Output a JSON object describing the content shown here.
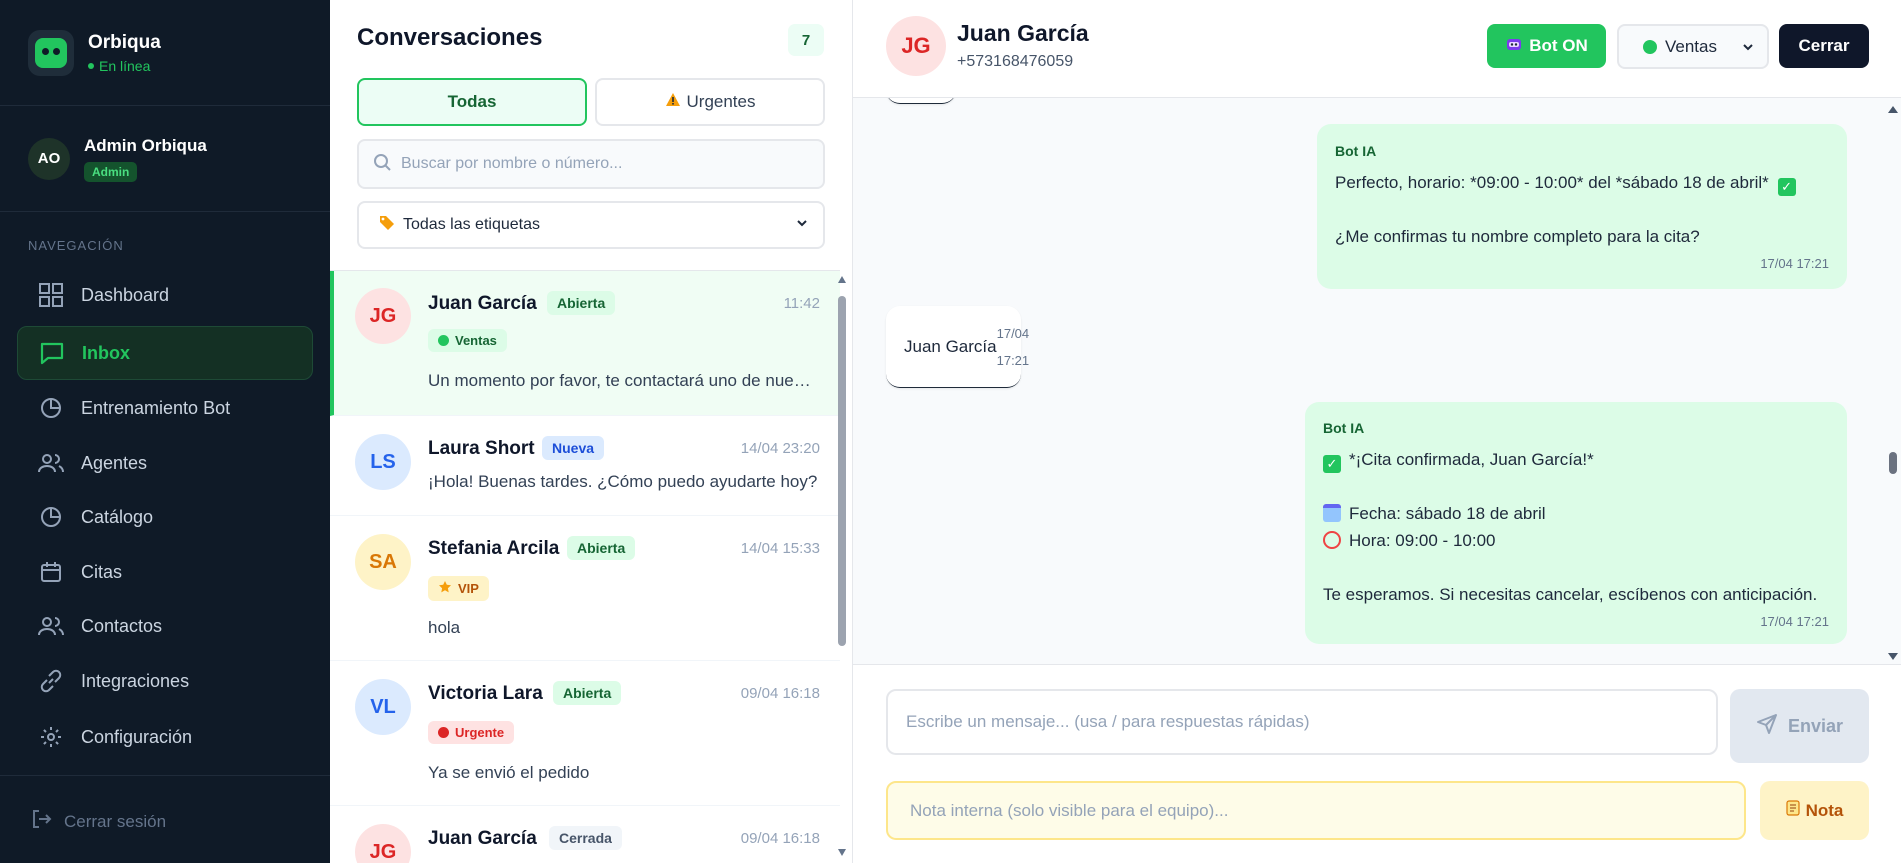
{
  "brand": {
    "name": "Orbiqua",
    "status": "En línea"
  },
  "user": {
    "initials": "AO",
    "name": "Admin Orbiqua",
    "role": "Admin"
  },
  "nav": {
    "section_label": "NAVEGACIÓN",
    "items": [
      {
        "label": "Dashboard",
        "icon": "grid-icon"
      },
      {
        "label": "Inbox",
        "icon": "chat-icon",
        "active": true
      },
      {
        "label": "Entrenamiento Bot",
        "icon": "pie-icon"
      },
      {
        "label": "Agentes",
        "icon": "users-icon"
      },
      {
        "label": "Catálogo",
        "icon": "pie-icon"
      },
      {
        "label": "Citas",
        "icon": "calendar-icon"
      },
      {
        "label": "Contactos",
        "icon": "users-icon"
      },
      {
        "label": "Integraciones",
        "icon": "link-icon"
      },
      {
        "label": "Configuración",
        "icon": "gear-icon"
      }
    ],
    "logout": "Cerrar sesión"
  },
  "conversations": {
    "title": "Conversaciones",
    "count": "7",
    "tabs": {
      "all": "Todas",
      "urgent": "Urgentes"
    },
    "search_placeholder": "Buscar por nombre o número...",
    "tag_filter": "Todas las etiquetas",
    "items": [
      {
        "initials": "JG",
        "name": "Juan García",
        "status": "Abierta",
        "time": "11:42",
        "label": "Ventas",
        "preview": "Un momento por favor, te contactará uno de nuestros asesores"
      },
      {
        "initials": "LS",
        "name": "Laura Short",
        "status": "Nueva",
        "time": "14/04 23:20",
        "label": "",
        "preview": "¡Hola! Buenas tardes. ¿Cómo puedo ayudarte hoy?"
      },
      {
        "initials": "SA",
        "name": "Stefania Arcila",
        "status": "Abierta",
        "time": "14/04 15:33",
        "label": "VIP",
        "preview": "hola"
      },
      {
        "initials": "VL",
        "name": "Victoria Lara",
        "status": "Abierta",
        "time": "09/04 16:18",
        "label": "Urgente",
        "preview": "Ya se envió el pedido"
      },
      {
        "initials": "JG",
        "name": "Juan García",
        "status": "Cerrada",
        "time": "09/04 16:18",
        "label": "",
        "preview": ""
      }
    ]
  },
  "chat": {
    "initials": "JG",
    "name": "Juan García",
    "phone": "+573168476059",
    "bot_button": "Bot ON",
    "department": "Ventas",
    "close_button": "Cerrar",
    "messages": [
      {
        "sender": "Bot IA",
        "lines": [
          "Perfecto, horario: *09:00 - 10:00* del *sábado 18 de abril*",
          "",
          "¿Me confirmas tu nombre completo para la cita?"
        ],
        "time": "17/04 17:21"
      },
      {
        "text": "Juan García",
        "time": "17/04 17:21"
      },
      {
        "sender": "Bot IA",
        "lines": [
          "*¡Cita confirmada, Juan García!*",
          "",
          "Fecha: sábado 18 de abril",
          "Hora: 09:00 - 10:00",
          "",
          "Te esperamos. Si necesitas cancelar, escíbenos con anticipación."
        ],
        "time": "17/04 17:21"
      }
    ],
    "composer_placeholder": "Escribe un mensaje... (usa / para respuestas rápidas)",
    "send_button": "Enviar",
    "note_placeholder": "Nota interna (solo visible para el equipo)...",
    "note_button": "Nota"
  },
  "colors": {
    "accent": "#22c55e",
    "sidebar_bg": "#0f1a27",
    "bot_bubble": "#dcfce7"
  }
}
